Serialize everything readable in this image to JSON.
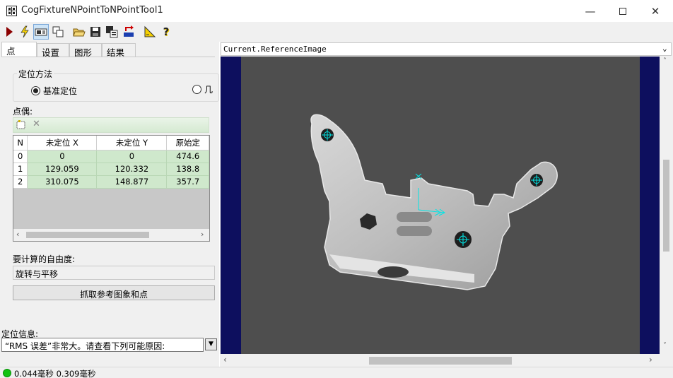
{
  "window": {
    "title": "CogFixtureNPointToNPointTool1"
  },
  "tabs": [
    {
      "label": "点"
    },
    {
      "label": "设置"
    },
    {
      "label": "图形"
    },
    {
      "label": "结果"
    }
  ],
  "locate": {
    "group_label": "定位方法",
    "option_1": "基准定位",
    "option_2": "几",
    "selected": "基准定位"
  },
  "pairs": {
    "label": "点偶:",
    "columns": [
      "N",
      "未定位 X",
      "未定位 Y",
      "原始定"
    ],
    "rows": [
      [
        "0",
        "0",
        "0",
        "474.6"
      ],
      [
        "1",
        "129.059",
        "120.332",
        "138.8"
      ],
      [
        "2",
        "310.075",
        "148.877",
        "357.7"
      ]
    ]
  },
  "dof": {
    "label": "要计算的自由度:",
    "value": "旋转与平移"
  },
  "grab_button": "抓取参考图象和点",
  "info": {
    "label": "定位信息:",
    "value": "“RMS 误差”非常大。请查看下列可能原因:"
  },
  "status": {
    "text": "0.044毫秒 0.309毫秒",
    "color": "#12c212"
  },
  "viewer": {
    "image_name": "Current.ReferenceImage"
  },
  "colors": {
    "image_border": "#0d0f5e",
    "graphics": "#00e5e5"
  }
}
